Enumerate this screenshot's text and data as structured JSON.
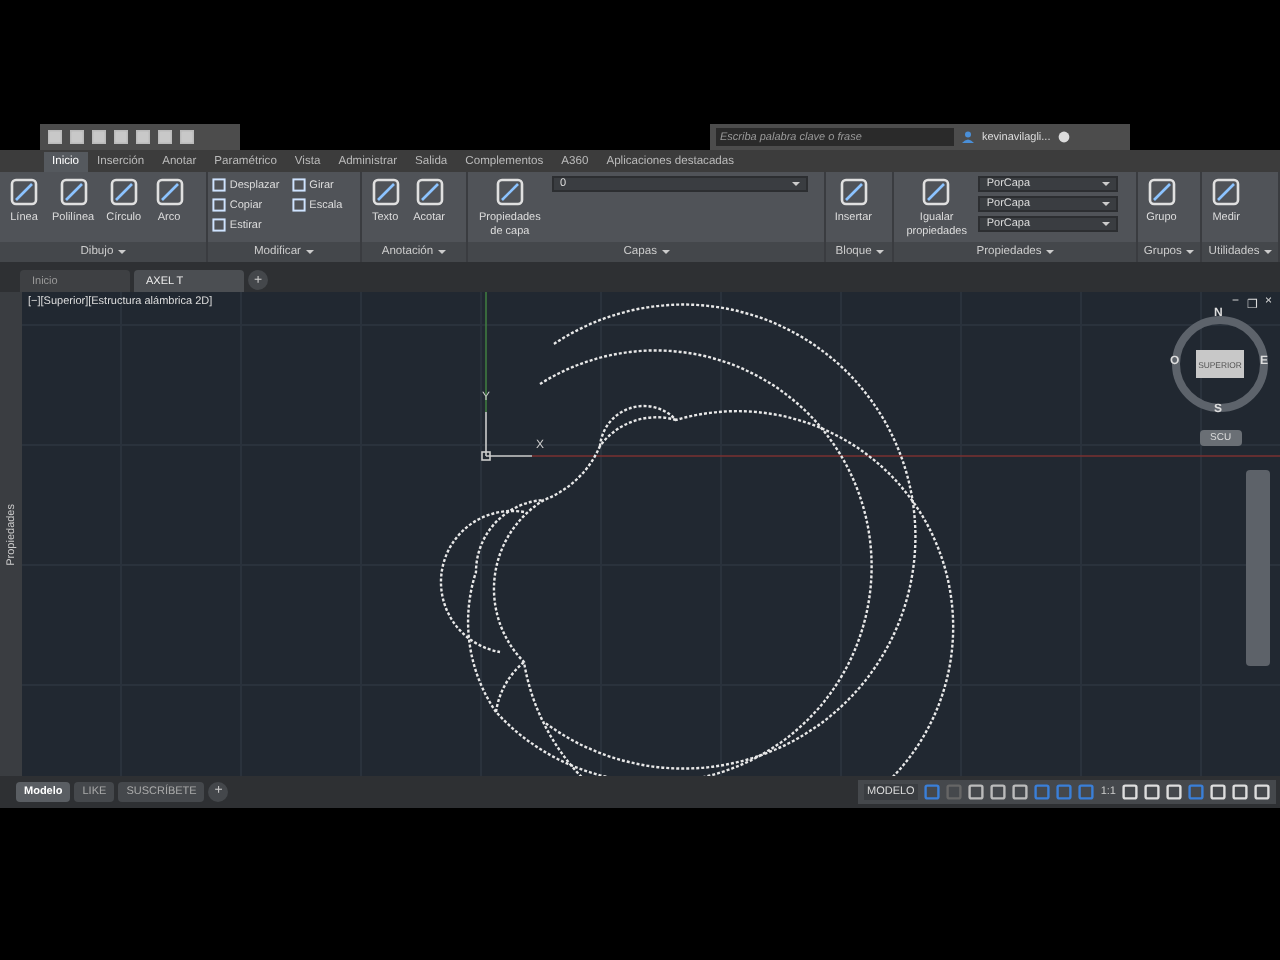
{
  "title_bar": {
    "search": {
      "placeholder": "Escriba palabra clave o frase"
    },
    "user": "kevinavilagli..."
  },
  "ribbon_tabs": [
    {
      "label": "Inicio",
      "selected": true
    },
    {
      "label": "Inserción",
      "selected": false
    },
    {
      "label": "Anotar",
      "selected": false
    },
    {
      "label": "Paramétrico",
      "selected": false
    },
    {
      "label": "Vista",
      "selected": false
    },
    {
      "label": "Administrar",
      "selected": false
    },
    {
      "label": "Salida",
      "selected": false
    },
    {
      "label": "Complementos",
      "selected": false
    },
    {
      "label": "A360",
      "selected": false
    },
    {
      "label": "Aplicaciones destacadas",
      "selected": false
    }
  ],
  "panels": [
    {
      "title": "Dibujo",
      "tools": [
        {
          "kind": "large",
          "label": "Línea"
        },
        {
          "kind": "large",
          "label": "Polilínea"
        },
        {
          "kind": "large",
          "label": "Círculo"
        },
        {
          "kind": "large",
          "label": "Arco"
        }
      ]
    },
    {
      "title": "Modificar",
      "tools": [
        {
          "kind": "small",
          "label": "Desplazar"
        },
        {
          "kind": "small",
          "label": "Copiar"
        },
        {
          "kind": "small",
          "label": "Estirar"
        },
        {
          "kind": "small",
          "label": "Girar"
        },
        {
          "kind": "small",
          "label": "Escala"
        }
      ]
    },
    {
      "title": "Anotación",
      "tools": [
        {
          "kind": "large",
          "label": "Texto"
        },
        {
          "kind": "large",
          "label": "Acotar"
        }
      ]
    },
    {
      "title": "Capas",
      "tools": [
        {
          "kind": "large",
          "label": "Propiedades de capa"
        },
        {
          "kind": "dropdown",
          "label": "0"
        }
      ]
    },
    {
      "title": "Bloque",
      "tools": [
        {
          "kind": "large",
          "label": "Insertar"
        }
      ]
    },
    {
      "title": "Propiedades",
      "tools": [
        {
          "kind": "large",
          "label": "Igualar propiedades"
        },
        {
          "kind": "dropdown",
          "label": "PorCapa"
        },
        {
          "kind": "dropdown",
          "label": "PorCapa"
        },
        {
          "kind": "dropdown",
          "label": "PorCapa"
        }
      ]
    },
    {
      "title": "Grupos",
      "tools": [
        {
          "kind": "large",
          "label": "Grupo"
        }
      ]
    },
    {
      "title": "Utilidades",
      "tools": [
        {
          "kind": "large",
          "label": "Medir"
        }
      ]
    }
  ],
  "document_tabs": {
    "tabs": [
      {
        "label": "Inicio",
        "selected": false
      },
      {
        "label": "AXEL T",
        "selected": true
      }
    ],
    "new_tab": "+"
  },
  "viewport": {
    "label": "[−][Superior][Estructura alámbrica 2D]",
    "window_controls": [
      "−",
      "❐",
      "×"
    ],
    "palette_label": "Propiedades",
    "axis_labels": [
      "Y",
      "X"
    ],
    "viewcube": {
      "face": "SUPERIOR",
      "north": "N",
      "south": "S",
      "east": "E",
      "west": "O",
      "ucs": "SCU"
    }
  },
  "layout_tabs": {
    "tabs": [
      {
        "label": "Modelo",
        "selected": true
      },
      {
        "label": "LIKE",
        "selected": false
      },
      {
        "label": "SUSCRÍBETE",
        "selected": false
      }
    ],
    "new_tab": "+"
  },
  "status_bar": {
    "space": "MODELO",
    "scale": "1:1"
  }
}
